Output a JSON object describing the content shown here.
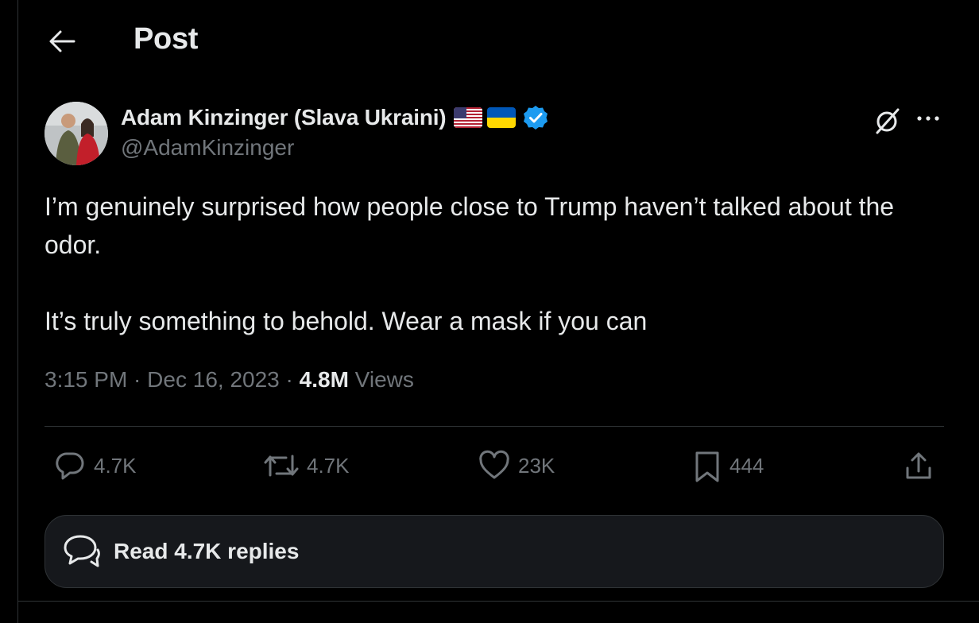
{
  "header": {
    "title": "Post",
    "back_icon": "arrow-left-icon"
  },
  "author": {
    "display_name": "Adam Kinzinger (Slava Ukraini)",
    "handle": "@AdamKinzinger",
    "flags": [
      "us-flag",
      "ukraine-flag"
    ],
    "verified": true,
    "verified_color": "#1d9bf0"
  },
  "post": {
    "paragraphs": [
      "I’m genuinely surprised how people close to Trump haven’t talked about the odor.",
      "It’s truly something to behold.  Wear a mask if you can"
    ],
    "time": "3:15 PM",
    "separator": " · ",
    "date": "Dec 16, 2023",
    "views_count": "4.8M",
    "views_label": "Views"
  },
  "actions": {
    "replies": "4.7K",
    "reposts": "4.7K",
    "likes": "23K",
    "bookmarks": "444"
  },
  "read_replies": {
    "label": "Read 4.7K replies"
  },
  "colors": {
    "background": "#000000",
    "text_primary": "#e7e9ea",
    "text_secondary": "#71767b",
    "border": "#2f3336",
    "card_bg": "#16181c"
  }
}
